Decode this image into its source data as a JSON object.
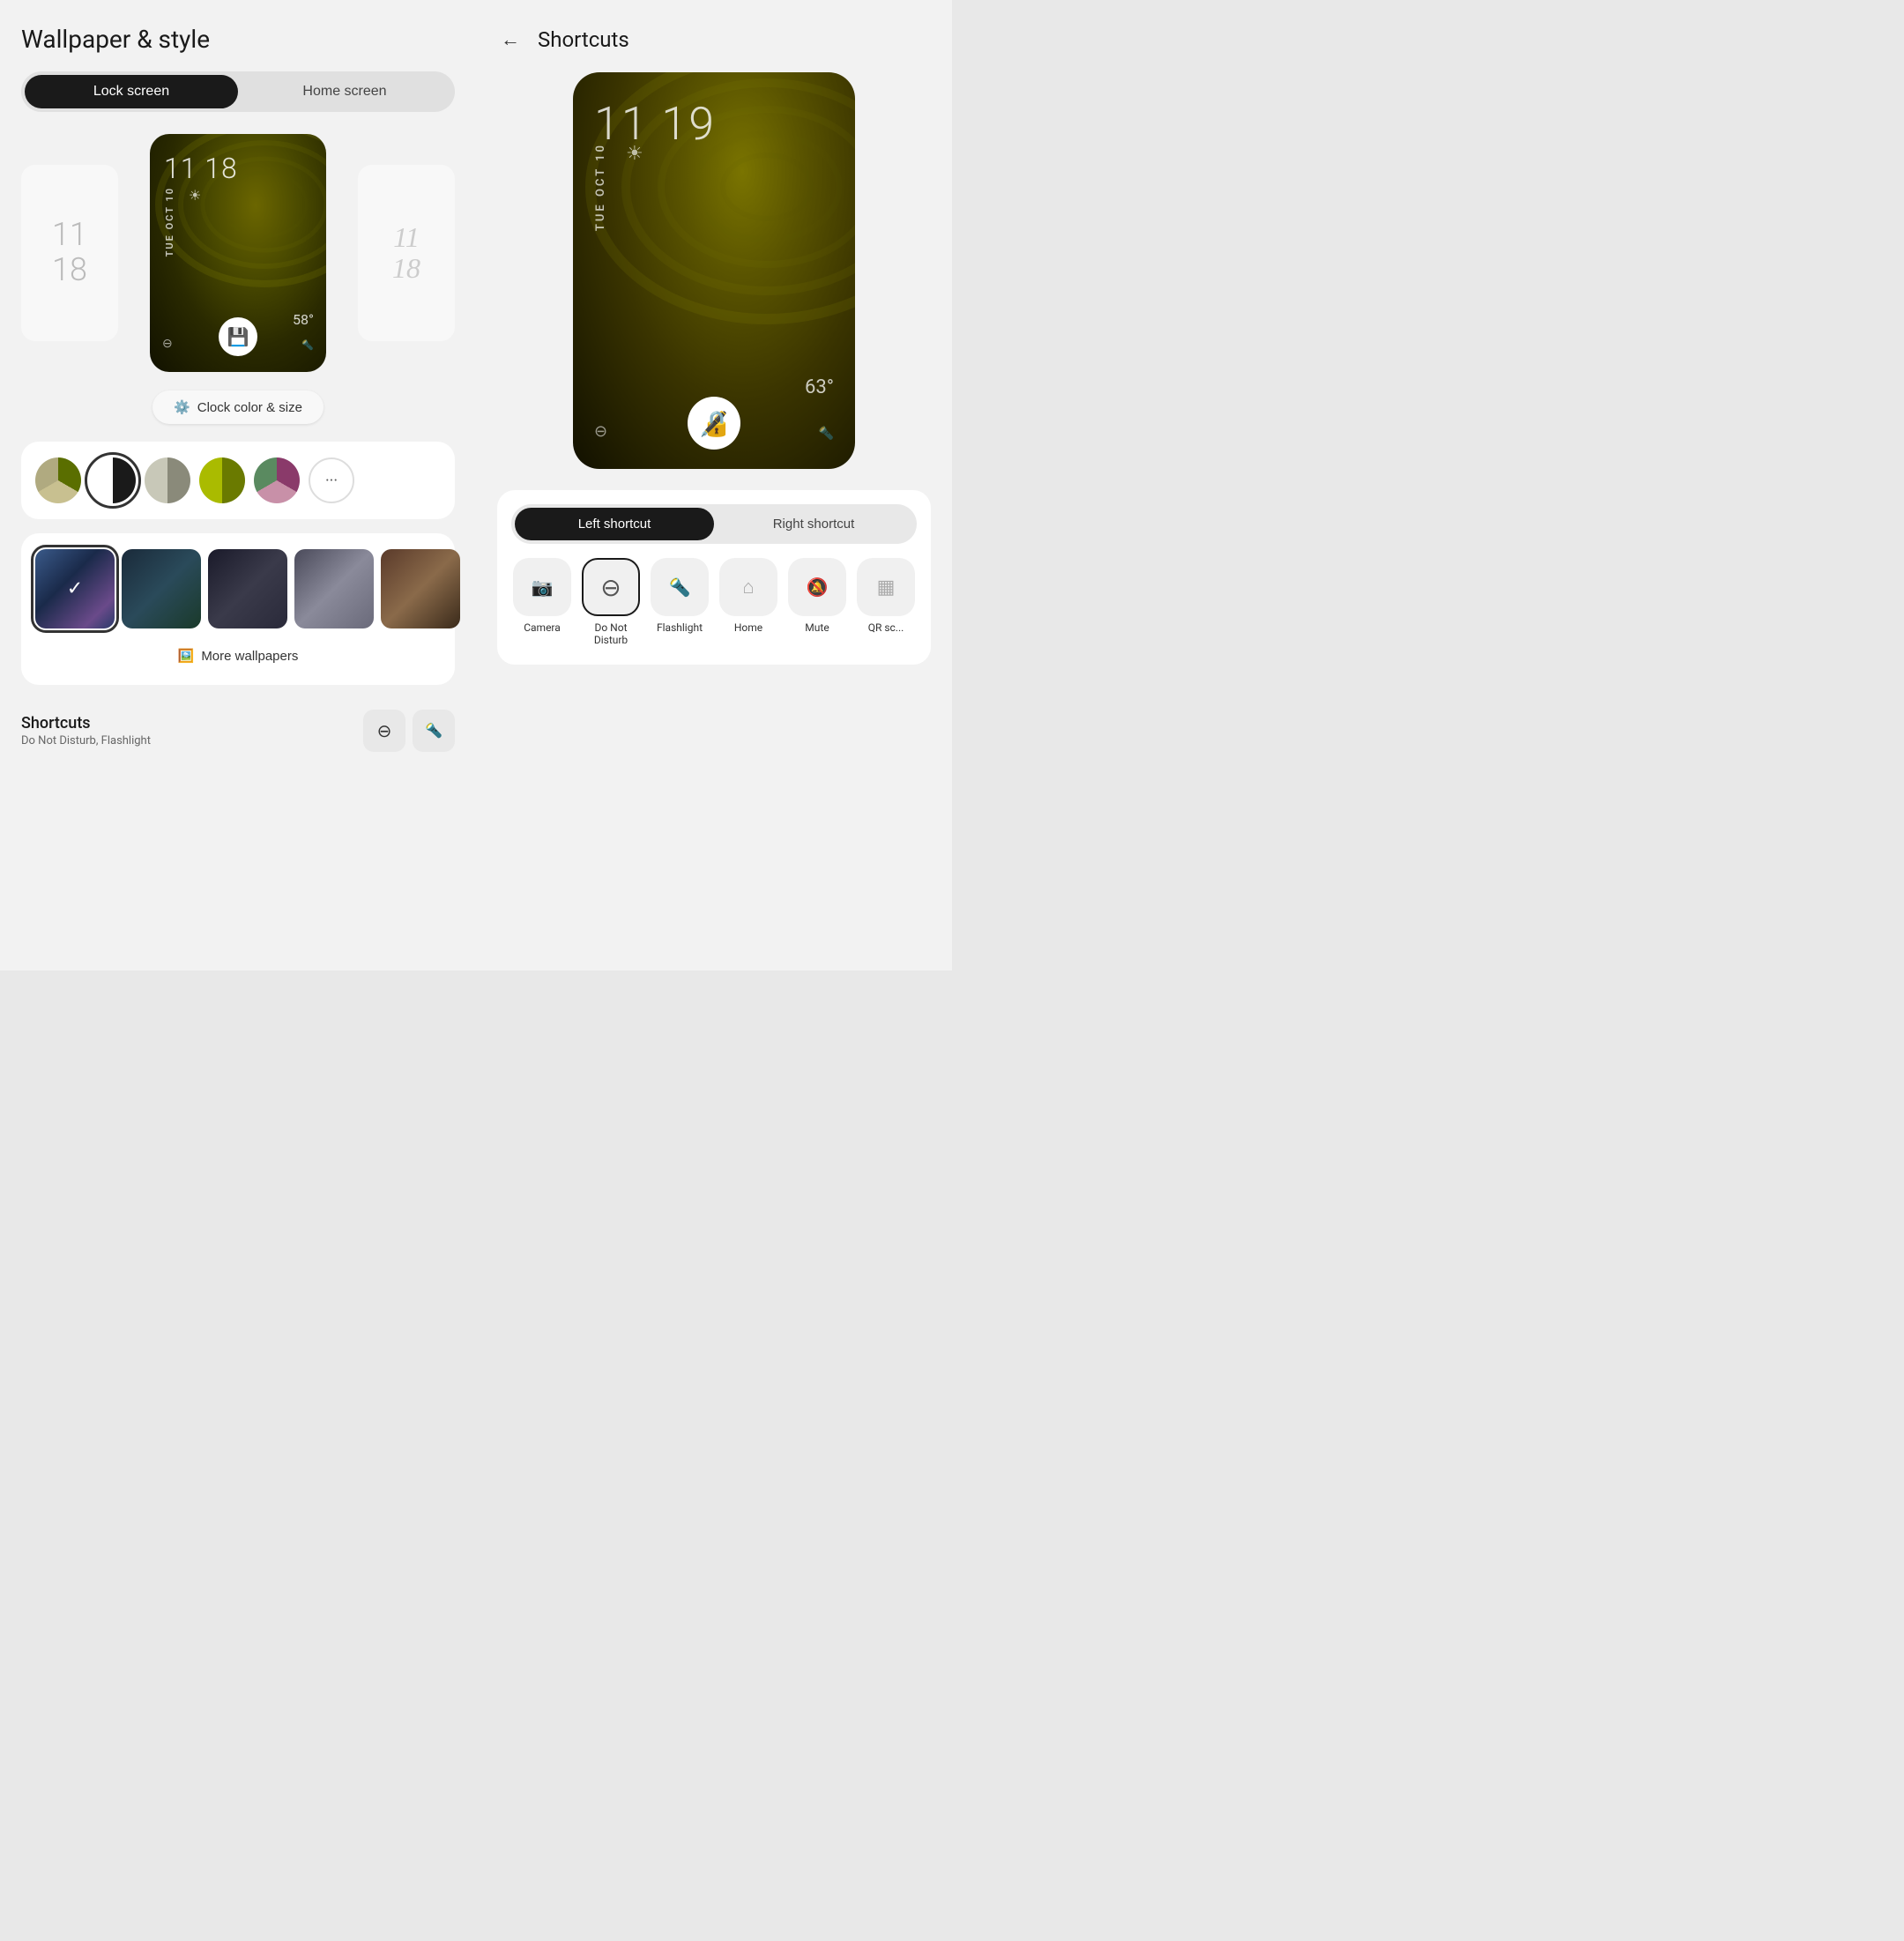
{
  "left": {
    "title": "Wallpaper & style",
    "tabs": [
      {
        "label": "Lock screen",
        "active": true
      },
      {
        "label": "Home screen",
        "active": false
      }
    ],
    "phone_preview": {
      "time": "11 18",
      "date": "TUE OCT 10",
      "weather": "☀️",
      "temp": "58°",
      "side_clock_left": "11\n18",
      "side_clock_right": "11\n18"
    },
    "clock_settings_label": "Clock color & size",
    "color_swatches": [
      {
        "id": "swatch-1",
        "color": "#5a6e00",
        "selected": false
      },
      {
        "id": "swatch-2",
        "color": "#1a1a1a",
        "selected": true
      },
      {
        "id": "swatch-3",
        "color": "#7a7a6a",
        "selected": false
      },
      {
        "id": "swatch-4",
        "color": "#6a7a00",
        "selected": false
      },
      {
        "id": "swatch-5",
        "color": "#8a3a6a",
        "selected": false
      }
    ],
    "wallpaper_thumbnails": [
      {
        "id": "thumb-1",
        "selected": true
      },
      {
        "id": "thumb-2",
        "selected": false
      },
      {
        "id": "thumb-3",
        "selected": false
      },
      {
        "id": "thumb-4",
        "selected": false
      },
      {
        "id": "thumb-5",
        "selected": false
      }
    ],
    "more_wallpapers_label": "More wallpapers",
    "shortcuts": {
      "title": "Shortcuts",
      "subtitle": "Do Not Disturb, Flashlight",
      "icons": [
        "⊖",
        "🔦"
      ]
    }
  },
  "right": {
    "back_label": "←",
    "title": "Shortcuts",
    "phone_preview": {
      "time": "11 19",
      "date": "TUE OCT 10",
      "weather": "☀",
      "temp": "63°"
    },
    "shortcut_tabs": [
      {
        "label": "Left shortcut",
        "active": true
      },
      {
        "label": "Right shortcut",
        "active": false
      }
    ],
    "shortcut_options": [
      {
        "id": "camera",
        "label": "Camera",
        "icon": "📷",
        "selected": false
      },
      {
        "id": "do-not-disturb",
        "label": "Do Not Disturb",
        "icon": "⊖",
        "selected": true
      },
      {
        "id": "flashlight",
        "label": "Flashlight",
        "icon": "🔦",
        "selected": false
      },
      {
        "id": "home",
        "label": "Home",
        "icon": "⌂",
        "selected": false
      },
      {
        "id": "mute",
        "label": "Mute",
        "icon": "🔕",
        "selected": false
      },
      {
        "id": "qr",
        "label": "QR sc...",
        "icon": "▦",
        "selected": false
      }
    ]
  }
}
